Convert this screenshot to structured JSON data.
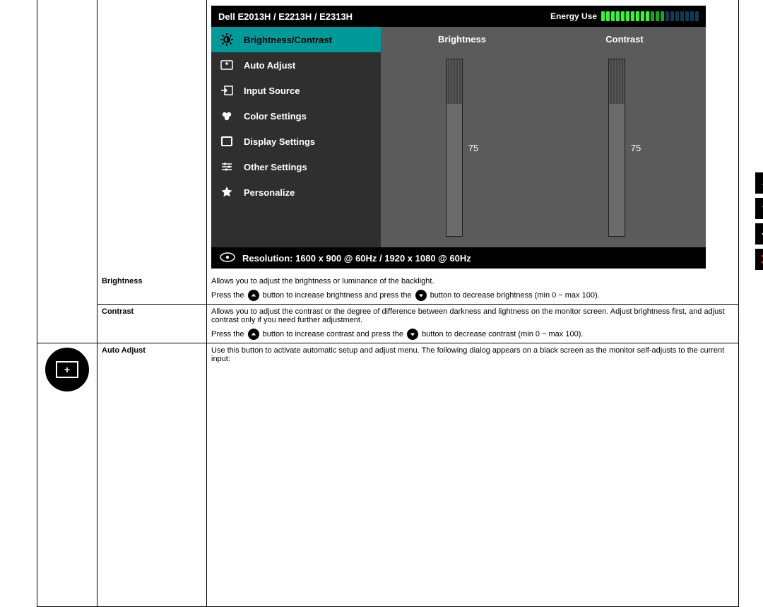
{
  "doc": {
    "brightness_label": "Brightness",
    "contrast_label": "Contrast",
    "autoadjust_label": "Auto Adjust",
    "brightness_desc": "Allows you to adjust the brightness or luminance of the backlight.",
    "brightness_action_a": "Press the ",
    "brightness_action_b": " button to increase brightness and press the ",
    "brightness_action_c": " button to decrease brightness (min 0 ~ max 100).",
    "contrast_desc": "Allows you to adjust the contrast or the degree of difference between darkness and lightness on the monitor screen. Adjust brightness first, and adjust contrast only if you need further adjustment.",
    "contrast_action_a": "Press the ",
    "contrast_action_b": " button to increase contrast and press the ",
    "contrast_action_c": " button to decrease contrast (min 0 ~ max 100).",
    "autoadjust_desc": "Use this button to activate automatic setup and adjust menu. The following dialog appears on a black screen as the monitor self-adjusts to the current input:"
  },
  "osd": {
    "header_title": "Dell E2013H / E2213H / E2313H",
    "energy_label": "Energy Use",
    "energy_bars_on": 13,
    "energy_bars_total": 20,
    "menu": [
      {
        "icon": "brightness-icon",
        "label": "Brightness/Contrast",
        "selected": true
      },
      {
        "icon": "auto-adjust-icon",
        "label": "Auto Adjust"
      },
      {
        "icon": "input-source-icon",
        "label": "Input Source"
      },
      {
        "icon": "color-settings-icon",
        "label": "Color Settings"
      },
      {
        "icon": "display-icon",
        "label": "Display Settings"
      },
      {
        "icon": "sliders-icon",
        "label": "Other Settings"
      },
      {
        "icon": "star-icon",
        "label": "Personalize"
      }
    ],
    "panelA": {
      "title": "Brightness",
      "value": 75
    },
    "panelB": {
      "title": "Contrast",
      "value": 75
    },
    "footer": "Resolution: 1600 x 900 @ 60Hz / 1920 x 1080 @ 60Hz"
  }
}
